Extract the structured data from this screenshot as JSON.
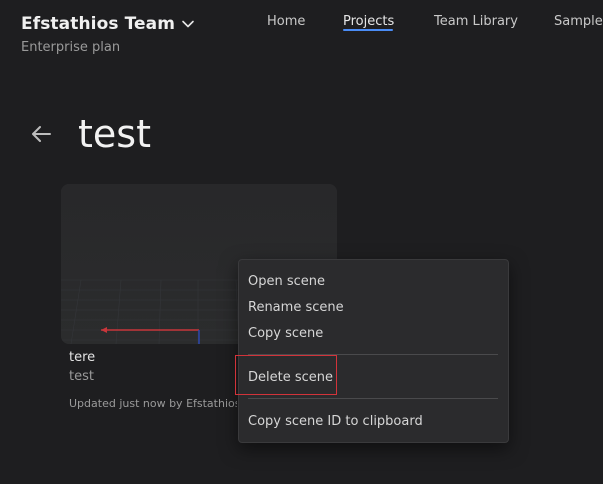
{
  "header": {
    "team_name": "Efstathios Team",
    "plan": "Enterprise plan",
    "nav": [
      {
        "label": "Home"
      },
      {
        "label": "Projects",
        "active": true
      },
      {
        "label": "Team Library"
      },
      {
        "label": "Samples"
      }
    ],
    "accent_color": "#4a8cf5"
  },
  "page": {
    "title": "test"
  },
  "scene_card": {
    "name": "tere",
    "project": "test",
    "updated": "Updated just now by Efstathios"
  },
  "context_menu": {
    "items": [
      {
        "label": "Open scene"
      },
      {
        "label": "Rename scene"
      },
      {
        "label": "Copy scene"
      },
      {
        "label": "Delete scene"
      },
      {
        "label": "Copy scene ID to clipboard"
      }
    ],
    "highlight_color": "#d2333a"
  }
}
